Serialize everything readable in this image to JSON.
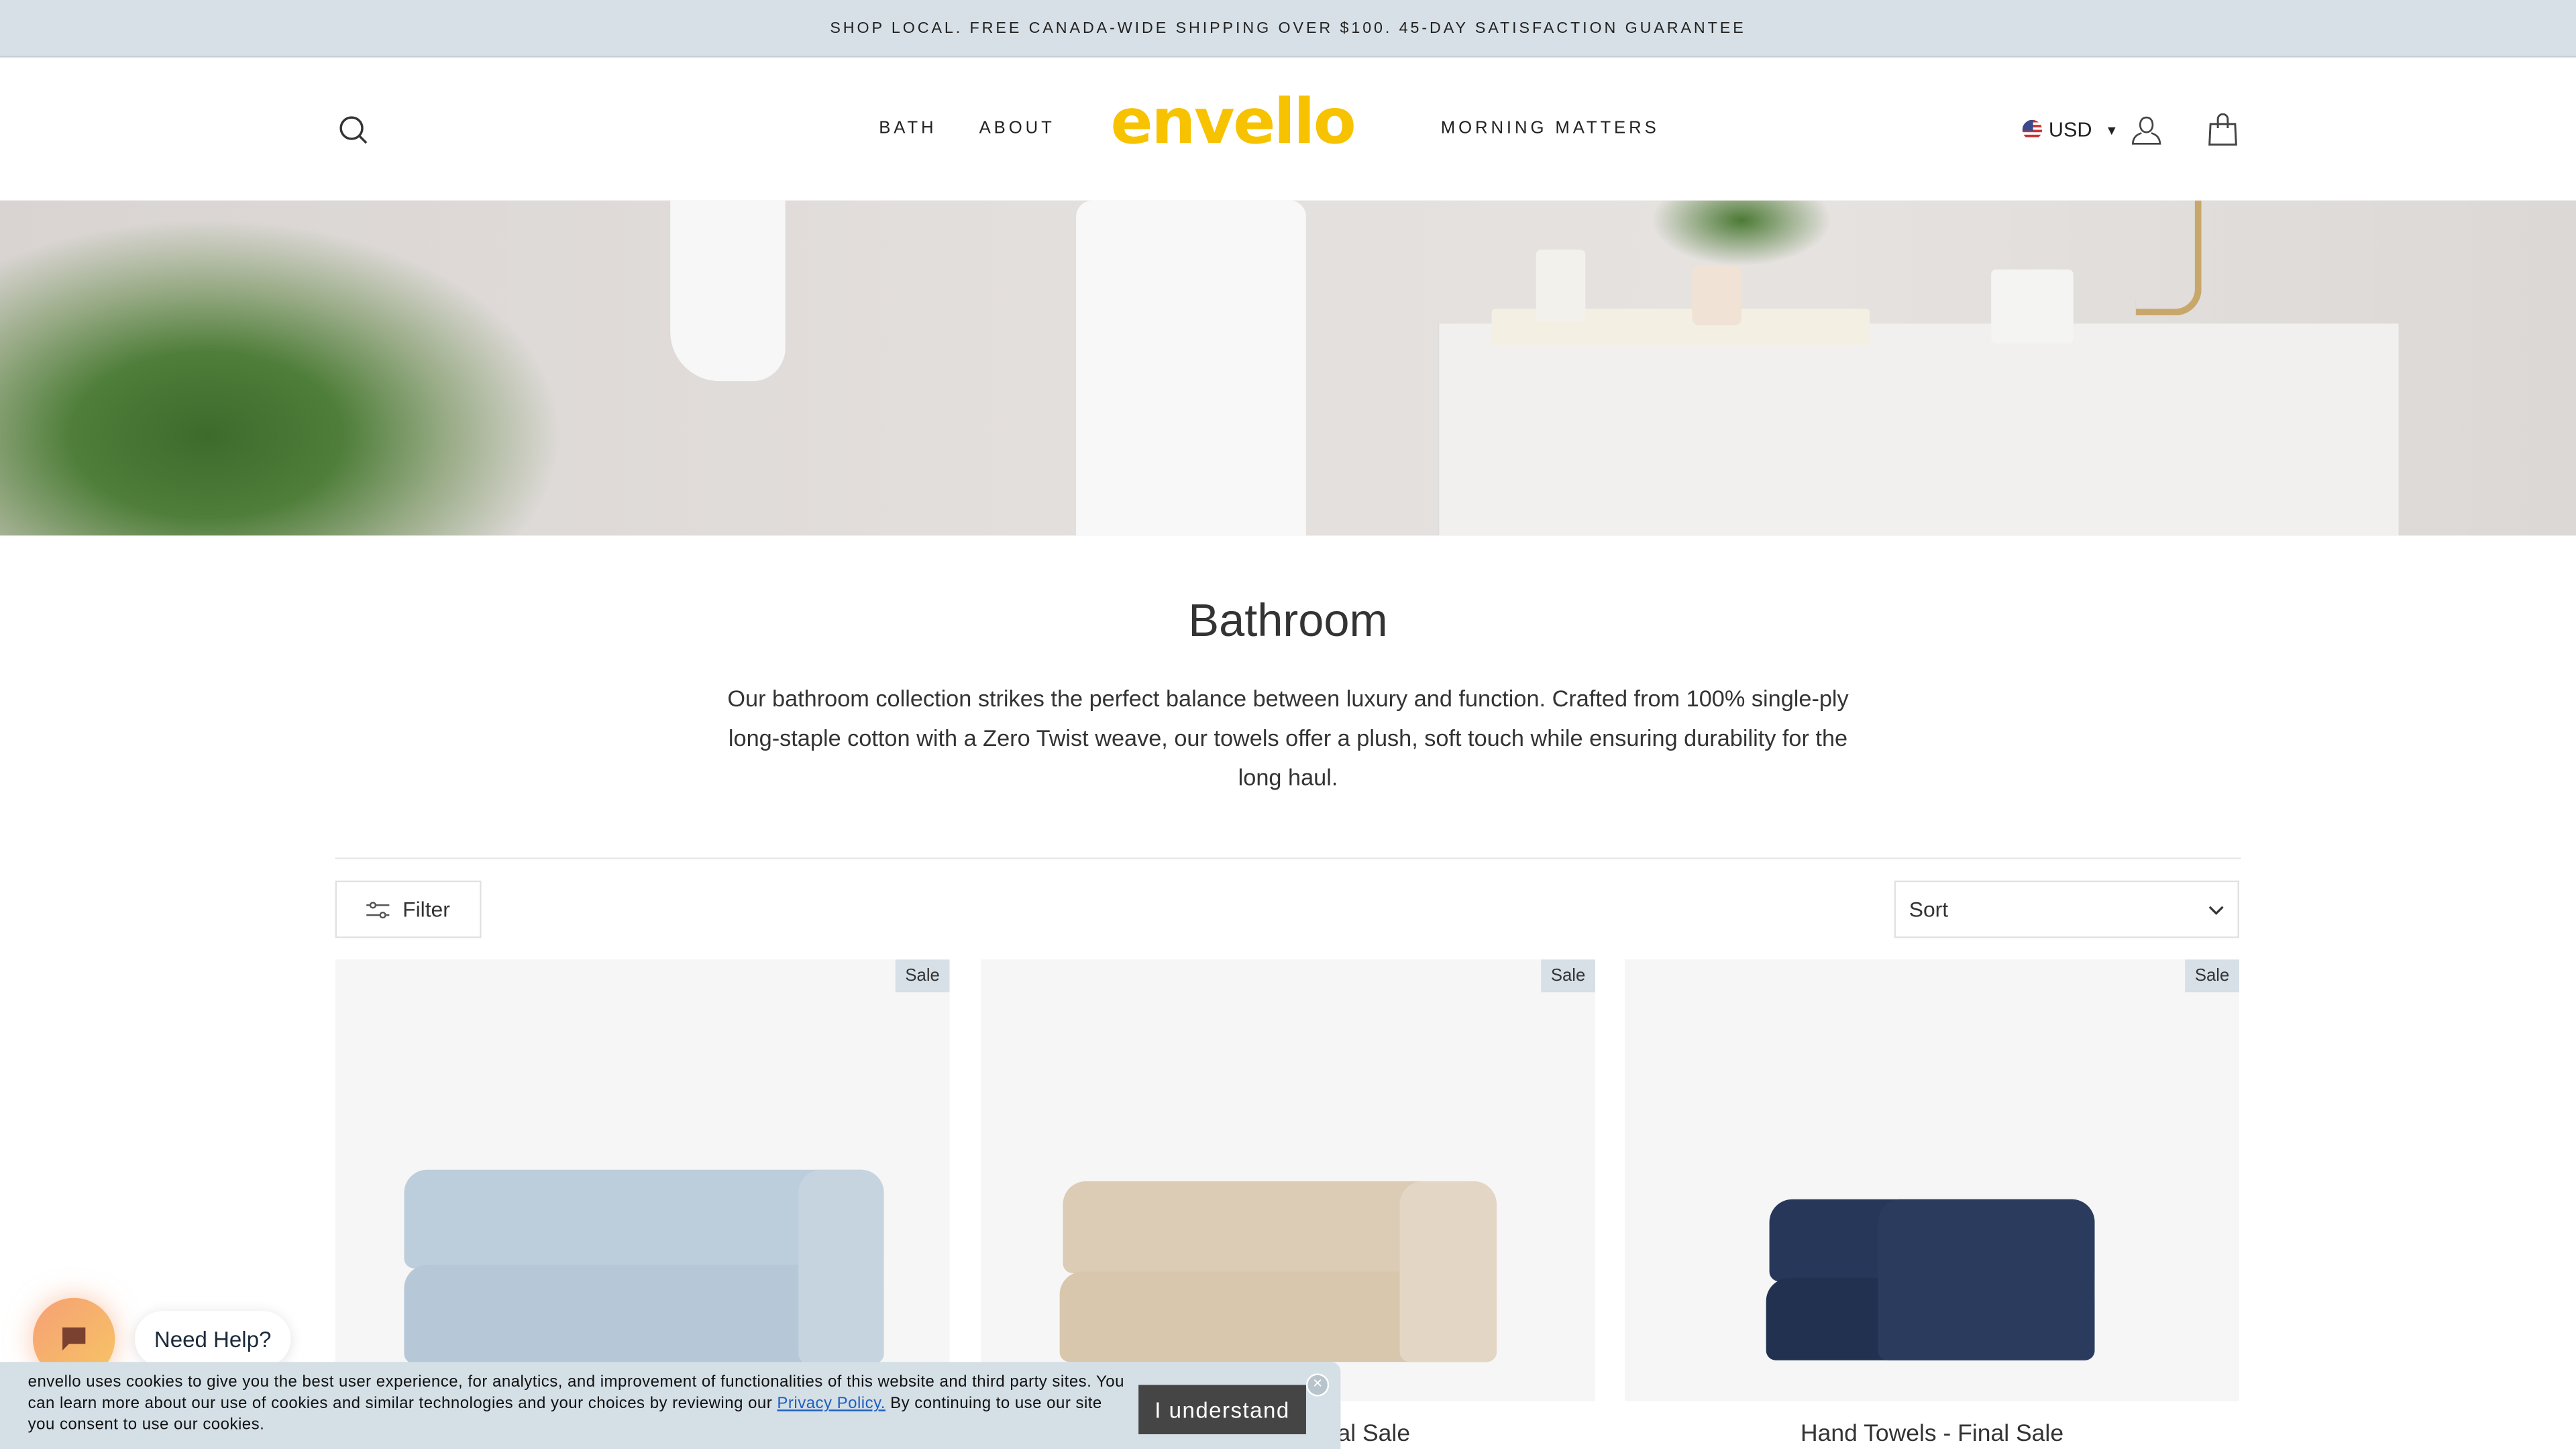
{
  "announcement": "SHOP LOCAL. FREE CANADA-WIDE SHIPPING OVER $100. 45-DAY SATISFACTION GUARANTEE",
  "header": {
    "logo": "envello",
    "nav": [
      "BATH",
      "ABOUT",
      "MORNING MATTERS"
    ],
    "currency": "USD",
    "icons": [
      "search-icon",
      "user-icon",
      "shopping-bag-icon",
      "us-flag-icon"
    ]
  },
  "colors": {
    "brand": "#f7c200",
    "announcement_bg": "#d6e0e6",
    "button_dark": "#454545"
  },
  "collection": {
    "title": "Bathroom",
    "description": "Our bathroom collection  strikes the perfect balance between luxury and function. Crafted from 100% single-ply long-staple cotton with a Zero Twist weave, our towels offer a plush, soft touch while ensuring durability for the long haul."
  },
  "toolbar": {
    "filter": "Filter",
    "sort": "Sort"
  },
  "products": [
    {
      "badge": "Sale",
      "title": "",
      "color": "#b9cad9"
    },
    {
      "badge": "Sale",
      "title": "al Sale",
      "color": "#dccab2"
    },
    {
      "badge": "Sale",
      "title": "Hand Towels - Final Sale",
      "color": "#25344f"
    }
  ],
  "chat": {
    "label": "Need Help?"
  },
  "cookie": {
    "text_before": "envello uses cookies to give you the best user experience, for analytics, and improvement of functionalities of this website and third party sites. You can learn more about our use of cookies and similar technologies and your choices by reviewing our ",
    "link": "Privacy Policy.",
    "text_after": " By continuing to use our site you consent to use our cookies.",
    "button": "I understand",
    "close": "×"
  }
}
